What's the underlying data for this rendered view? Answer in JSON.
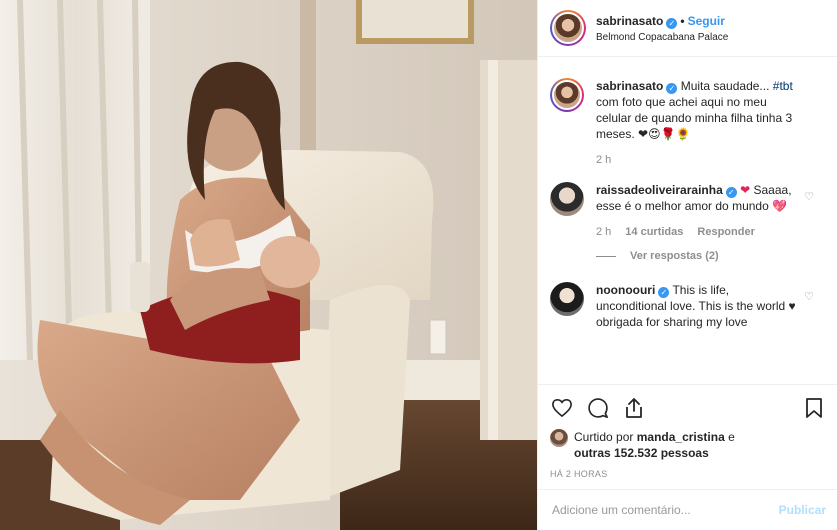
{
  "post": {
    "author": "sabrinasato",
    "follow_label": "Seguir",
    "separator": "•",
    "location": "Belmond Copacabana Palace"
  },
  "comments": [
    {
      "username": "sabrinasato",
      "text": "Muita saudade...",
      "hashtag": "#tbt",
      "text_after": "com foto que achei aqui no meu celular de quando minha filha tinha 3 meses.",
      "emojis": "❤😍🌹🌻",
      "time": "2 h"
    },
    {
      "username": "raissadeoliveirarainha",
      "username_emoji": "❤",
      "text": "Saaaa, esse é o melhor amor do mundo",
      "text_emoji": "💖",
      "time": "2 h",
      "likes": "14 curtidas",
      "reply_label": "Responder",
      "view_replies": "Ver respostas (2)"
    },
    {
      "username": "noonoouri",
      "text": "This is life, unconditional love. This is the world ♥ obrigada for sharing my love"
    }
  ],
  "actions": {
    "liked_by_prefix": "Curtido por",
    "liked_by_user": "manda_cristina",
    "liked_by_mid": "e",
    "liked_by_count": "outras 152.532 pessoas",
    "time_ago": "HÁ 2 HORAS"
  },
  "add_comment": {
    "placeholder": "Adicione um comentário...",
    "post_label": "Publicar"
  },
  "icons": {
    "verified": "verified-badge-icon",
    "like": "heart-icon",
    "comment": "comment-bubble-icon",
    "share": "share-icon",
    "save": "bookmark-icon"
  },
  "colors": {
    "link_blue": "#3897f0",
    "text": "#262626",
    "muted": "#8e8e8e"
  }
}
